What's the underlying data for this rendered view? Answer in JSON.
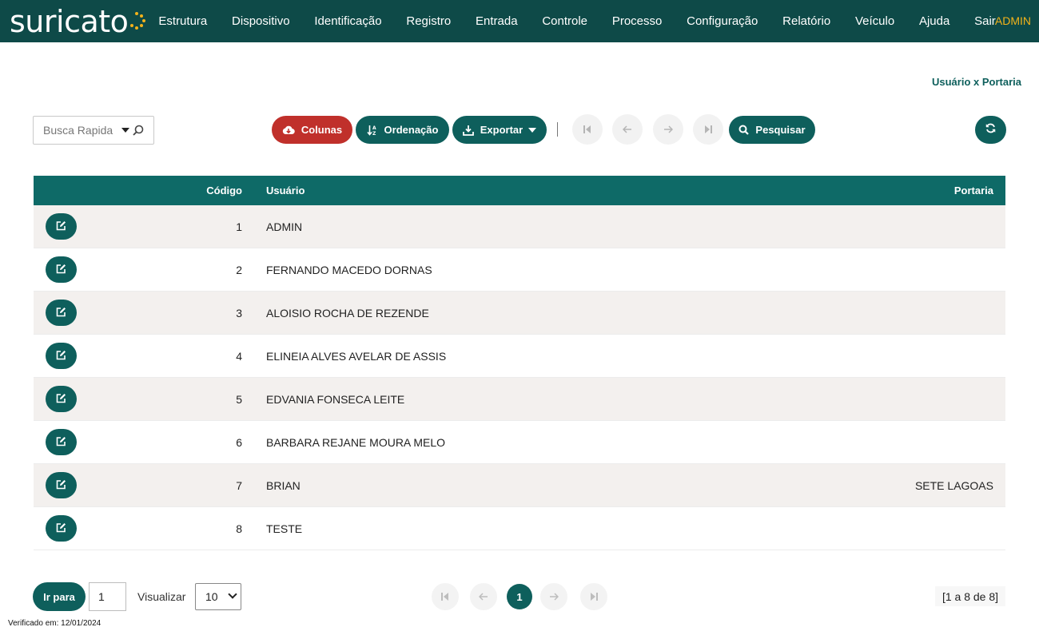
{
  "brand": {
    "name": "suricato",
    "accent": "#f2b21a",
    "primary": "#0e5f5c",
    "danger": "#c0302b"
  },
  "nav": {
    "items": [
      "Estrutura",
      "Dispositivo",
      "Identificação",
      "Registro",
      "Entrada",
      "Controle",
      "Processo",
      "Configuração",
      "Relatório",
      "Veículo",
      "Ajuda",
      "Sair"
    ],
    "user": "ADMIN"
  },
  "page": {
    "title": "Usuário x Portaria"
  },
  "toolbar": {
    "quick_search_placeholder": "Busca Rapida",
    "columns_label": "Colunas",
    "order_label": "Ordenação",
    "export_label": "Exportar",
    "search_label": "Pesquisar"
  },
  "table": {
    "headers": {
      "code": "Código",
      "user": "Usuário",
      "portaria": "Portaria"
    },
    "rows": [
      {
        "code": "1",
        "user": "ADMIN",
        "portaria": ""
      },
      {
        "code": "2",
        "user": "FERNANDO MACEDO DORNAS",
        "portaria": ""
      },
      {
        "code": "3",
        "user": "ALOISIO ROCHA DE REZENDE",
        "portaria": ""
      },
      {
        "code": "4",
        "user": "ELINEIA ALVES AVELAR DE ASSIS",
        "portaria": ""
      },
      {
        "code": "5",
        "user": "EDVANIA FONSECA LEITE",
        "portaria": ""
      },
      {
        "code": "6",
        "user": "BARBARA REJANE MOURA MELO",
        "portaria": ""
      },
      {
        "code": "7",
        "user": "BRIAN",
        "portaria": "SETE LAGOAS"
      },
      {
        "code": "8",
        "user": "TESTE",
        "portaria": ""
      }
    ]
  },
  "footer": {
    "goto_label": "Ir para",
    "goto_value": "1",
    "view_label": "Visualizar",
    "view_value": "10",
    "current_page": "1",
    "range": "[1 a 8 de 8]",
    "verified": "Verificado em: 12/01/2024"
  }
}
